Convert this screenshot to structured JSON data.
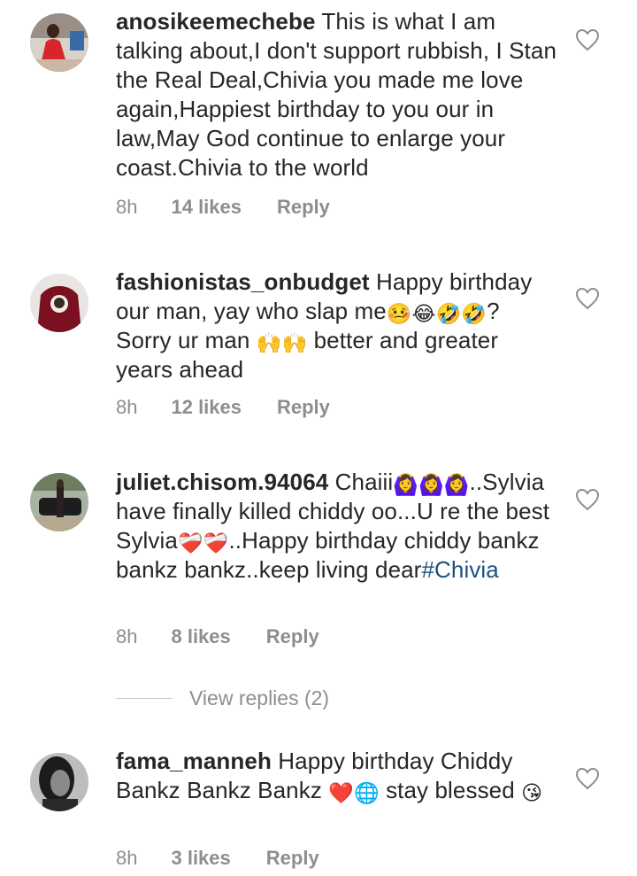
{
  "comments": [
    {
      "username": "anosikeemechebe",
      "text": "This is what I am talking about,I don't support rubbish, I Stan the Real Deal,Chivia you made me love again,Happiest birthday to you our in law,May God continue to enlarge your coast.Chivia to the world",
      "time": "8h",
      "likes": "14 likes",
      "reply": "Reply"
    },
    {
      "username": "fashionistas_onbudget",
      "text_a": "Happy birthday our man, yay who slap me",
      "emoji_a": "🤒😂🤣🤣",
      "text_b": "? Sorry ur man ",
      "emoji_b": "🙌🙌",
      "text_c": " better and greater years ahead",
      "time": "8h",
      "likes": "12 likes",
      "reply": "Reply"
    },
    {
      "username": "juliet.chisom.94064",
      "text_a": "Chaiii",
      "emoji_a": "🙆‍♀️🙆‍♀️🙆‍♀️",
      "text_b": "..Sylvia have finally killed chiddy oo...U re the best Sylvia",
      "emoji_b": "❤️‍🩹❤️‍🩹",
      "text_c": "..Happy birthday chiddy bankz bankz bankz..keep living dear",
      "hashtag": "#Chivia",
      "time": "8h",
      "likes": "8 likes",
      "reply": "Reply",
      "view_replies": "View replies (2)"
    },
    {
      "username": "fama_manneh",
      "text_a": "Happy birthday Chiddy Bankz Bankz Bankz ",
      "emoji_a": "❤️🌐",
      "text_b": " stay blessed ",
      "emoji_b": "😘",
      "time": "8h",
      "likes": "3 likes",
      "reply": "Reply"
    }
  ],
  "icons": {
    "like": "heart-outline-icon"
  },
  "colors": {
    "hashtag": "#1d4f7d",
    "meta": "#8e8e8e",
    "text": "#262626"
  }
}
